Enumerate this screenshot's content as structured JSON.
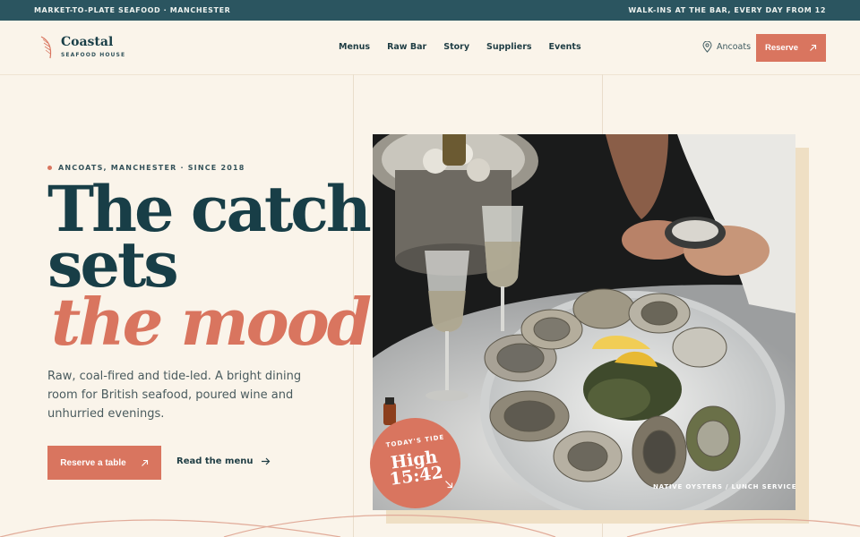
{
  "topbar": {
    "left": "MARKET-TO-PLATE SEAFOOD · MANCHESTER",
    "right": "WALK-INS AT THE BAR, EVERY DAY FROM 12"
  },
  "brand": {
    "name": "Coastal",
    "sub": "SEAFOOD HOUSE",
    "icon": "feather-icon"
  },
  "nav": {
    "items": [
      {
        "label": "Menus"
      },
      {
        "label": "Raw Bar"
      },
      {
        "label": "Story"
      },
      {
        "label": "Suppliers"
      },
      {
        "label": "Events"
      }
    ],
    "location": "Ancoats",
    "location_icon": "map-pin-icon",
    "reserve": "Reserve",
    "reserve_icon": "arrow-up-right-icon"
  },
  "hero": {
    "eyebrow": "ANCOATS, MANCHESTER · SINCE 2018",
    "headline_1": "The catch",
    "headline_2": "sets",
    "headline_3": "the mood.",
    "lead": "Raw, coal-fired and tide-led. A bright dining room for British seafood, poured wine and unhurried evenings.",
    "cta_primary": "Reserve a table",
    "cta_secondary": "Read the menu"
  },
  "photo": {
    "caption": "NATIVE OYSTERS / LUNCH SERVICE"
  },
  "badge": {
    "label": "TODAY'S TIDE",
    "line1": "High",
    "line2": "15:42"
  },
  "colors": {
    "accent": "#d9755f",
    "ink": "#183e47",
    "topbar": "#2b5560",
    "background": "#faf4ea"
  }
}
